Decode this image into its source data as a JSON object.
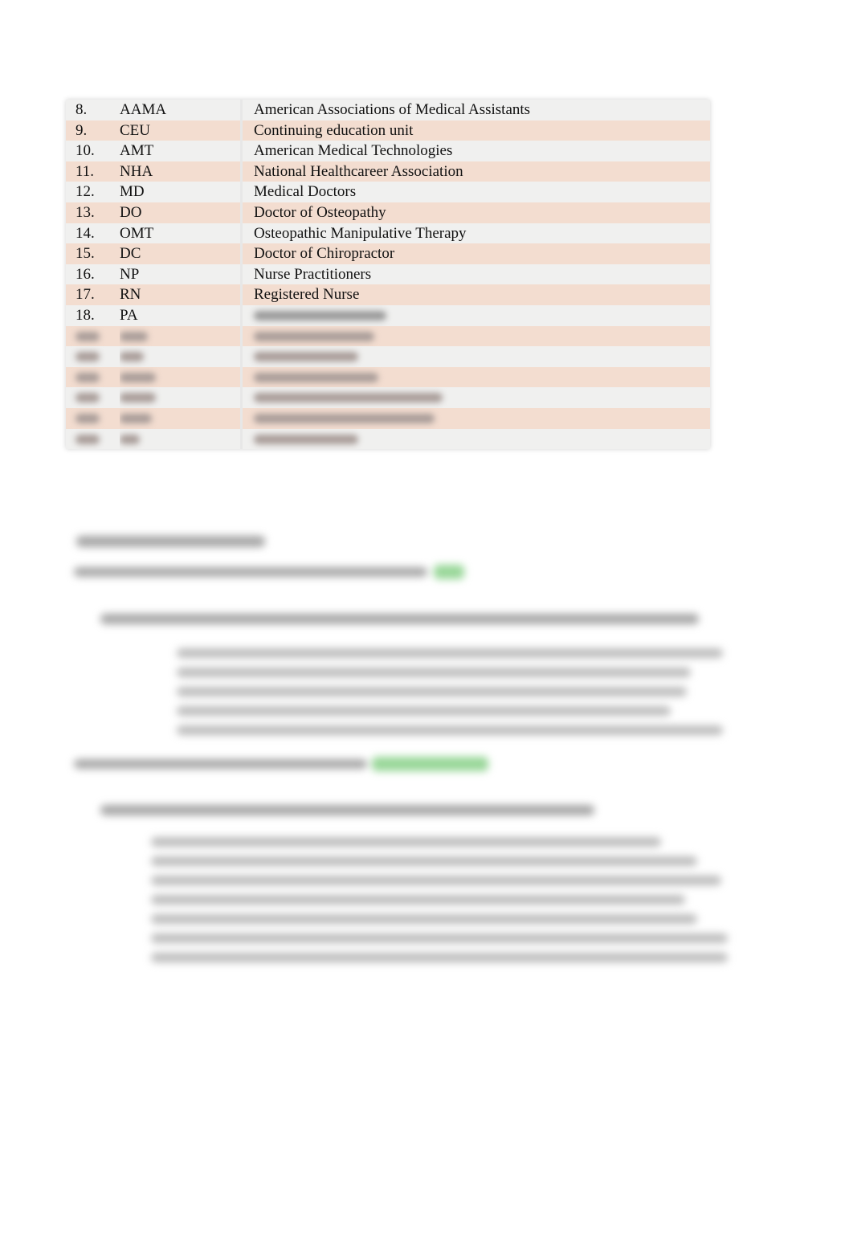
{
  "abbreviation_table": {
    "rows": [
      {
        "num": "8.",
        "abbr": "AAMA",
        "definition": "American Associations of Medical Assistants"
      },
      {
        "num": "9.",
        "abbr": "CEU",
        "definition": "Continuing education unit"
      },
      {
        "num": "10.",
        "abbr": "AMT",
        "definition": "American Medical Technologies"
      },
      {
        "num": "11.",
        "abbr": "NHA",
        "definition": "National Healthcareer Association"
      },
      {
        "num": "12.",
        "abbr": "MD",
        "definition": "Medical Doctors"
      },
      {
        "num": "13.",
        "abbr": "DO",
        "definition": "Doctor of Osteopathy"
      },
      {
        "num": "14.",
        "abbr": "OMT",
        "definition": "Osteopathic Manipulative Therapy"
      },
      {
        "num": "15.",
        "abbr": "DC",
        "definition": "Doctor of Chiropractor"
      },
      {
        "num": "16.",
        "abbr": "NP",
        "definition": "Nurse Practitioners"
      },
      {
        "num": "17.",
        "abbr": "RN",
        "definition": "Registered Nurse"
      },
      {
        "num": "18.",
        "abbr": "PA",
        "definition": ""
      }
    ],
    "obscured_row_count": 6
  },
  "colors": {
    "row_odd": "#f0f0ef",
    "row_even": "#f3ddd0",
    "highlight": "#8ed38e"
  },
  "obscured_sections": {
    "note": "Remaining document content is blurred and illegible"
  }
}
